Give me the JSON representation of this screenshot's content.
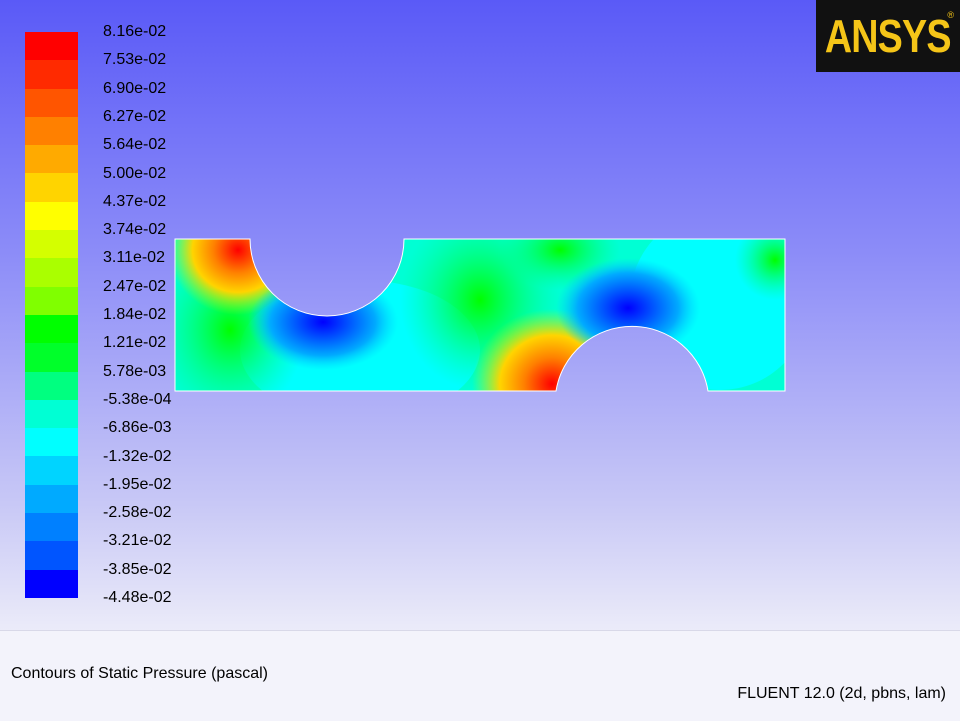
{
  "window": {
    "caption": "Contours of Static Pressure (pascal)",
    "version": "FLUENT 12.0 (2d, pbns, lam)"
  },
  "logo": {
    "text": "ANSYS",
    "mark": "®"
  },
  "legend": {
    "ticks": [
      "8.16e-02",
      "7.53e-02",
      "6.90e-02",
      "6.27e-02",
      "5.64e-02",
      "5.00e-02",
      "4.37e-02",
      "3.74e-02",
      "3.11e-02",
      "2.47e-02",
      "1.84e-02",
      "1.21e-02",
      "5.78e-03",
      "-5.38e-04",
      "-6.86e-03",
      "-1.32e-02",
      "-1.95e-02",
      "-2.58e-02",
      "-3.21e-02",
      "-3.85e-02",
      "-4.48e-02"
    ],
    "colors": [
      "#ff0000",
      "#ff2a00",
      "#ff5500",
      "#ff8000",
      "#ffaa00",
      "#ffd400",
      "#ffff00",
      "#d4ff00",
      "#aaff00",
      "#80ff00",
      "#00ff00",
      "#00ff2a",
      "#00ff80",
      "#00ffd4",
      "#00ffff",
      "#00d4ff",
      "#00aaff",
      "#0080ff",
      "#0055ff",
      "#0000ff"
    ]
  },
  "chart_data": {
    "type": "heatmap",
    "title": "Contours of Static Pressure (pascal)",
    "unit": "pascal",
    "range": [
      -0.0448,
      0.0816
    ],
    "levels": 20
  }
}
